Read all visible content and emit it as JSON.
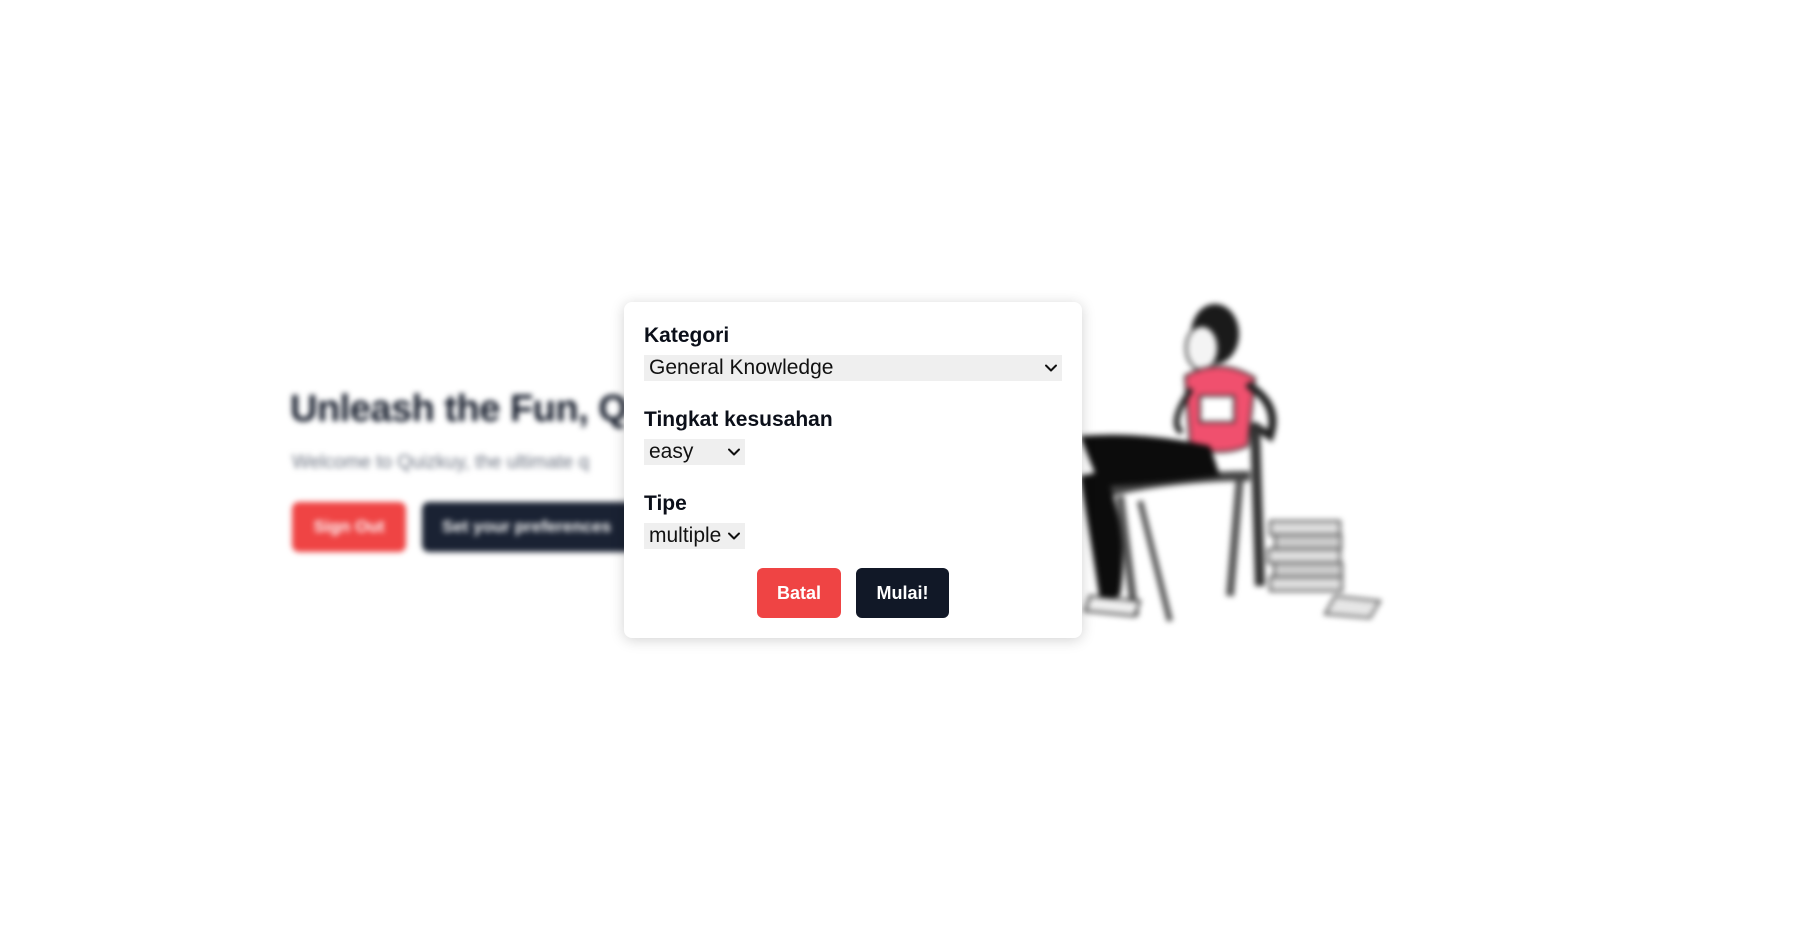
{
  "background": {
    "hero_title": "Unleash the Fun, Qu",
    "hero_subtitle": "Welcome to Quizkuy, the ultimate q",
    "sign_out_label": "Sign Out",
    "preferences_label": "Set your preferences"
  },
  "modal": {
    "category": {
      "label": "Kategori",
      "value": "General Knowledge"
    },
    "difficulty": {
      "label": "Tingkat kesusahan",
      "value": "easy"
    },
    "type": {
      "label": "Tipe",
      "value": "multiple"
    },
    "cancel_label": "Batal",
    "start_label": "Mulai!"
  },
  "colors": {
    "danger": "#ef4444",
    "primary_dark": "#111827",
    "select_bg": "#efefef",
    "illustration_accent": "#f0506e"
  }
}
